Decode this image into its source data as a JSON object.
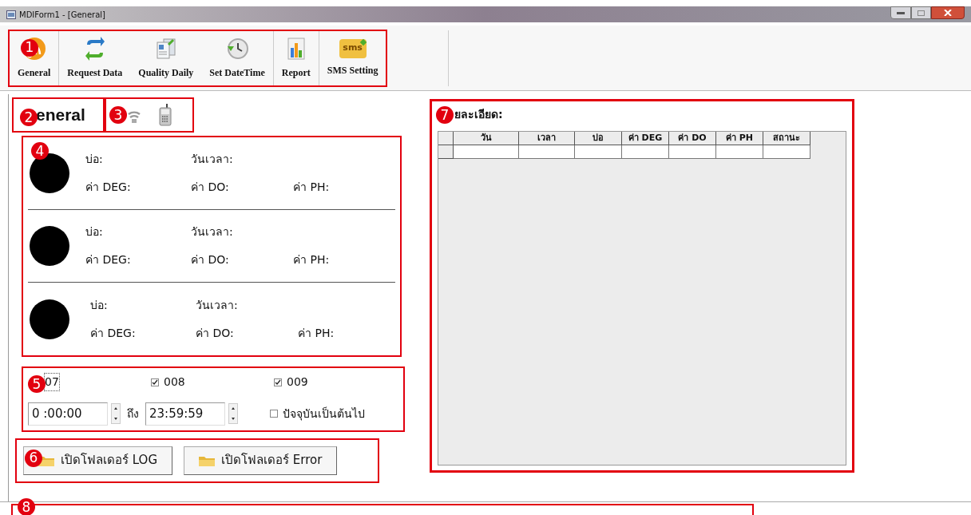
{
  "window": {
    "title": "MDIForm1 - [General]"
  },
  "toolbar": {
    "annotation": "1",
    "items": [
      {
        "label": "General",
        "kind": "rss"
      },
      {
        "label": "Request Data",
        "kind": "swap"
      },
      {
        "label": "Quality Daily",
        "kind": "document"
      },
      {
        "label": "Set DateTime",
        "kind": "clock"
      },
      {
        "label": "Report",
        "kind": "chart"
      },
      {
        "label": "SMS Setting",
        "kind": "sms",
        "icon_text": "sms"
      }
    ]
  },
  "header": {
    "annotation": "2",
    "title": "eneral"
  },
  "status_icons": {
    "annotation": "3"
  },
  "ponds": {
    "annotation": "4",
    "rows": [
      {
        "pond": "บ่อ:",
        "datetime": "วันเวลา:",
        "deg": "ค่า DEG:",
        "do": "ค่า DO:",
        "ph": "ค่า PH:"
      },
      {
        "pond": "บ่อ:",
        "datetime": "วันเวลา:",
        "deg": "ค่า DEG:",
        "do": "ค่า DO:",
        "ph": "ค่า PH:"
      },
      {
        "pond": "บ่อ:",
        "datetime": "วันเวลา:",
        "deg": "ค่า DEG:",
        "do": "ค่า DO:",
        "ph": "ค่า PH:"
      }
    ]
  },
  "filter": {
    "annotation": "5",
    "checkboxes": [
      {
        "label": "07",
        "kind": "covered"
      },
      {
        "label": "008",
        "kind": "checkbox",
        "checked": true
      },
      {
        "label": "009",
        "kind": "checkbox",
        "checked": true
      }
    ],
    "from": "0 :00:00",
    "to_label": "ถึง",
    "to": "23:59:59",
    "current": {
      "label": "ปัจจุบันเป็นต้นไป",
      "checked": false
    }
  },
  "folder_buttons": {
    "annotation": "6",
    "items": [
      "เปิดโฟลเดอร์ LOG",
      "เปิดโฟลเดอร์ Error"
    ]
  },
  "detail": {
    "annotation": "7",
    "title": "ยละเอียด:",
    "columns": [
      "วัน",
      "เวลา",
      "บ่อ",
      "ค่า DEG",
      "ค่า DO",
      "ค่า PH",
      "สถานะ"
    ]
  },
  "status_bar": {
    "annotation": "8"
  }
}
